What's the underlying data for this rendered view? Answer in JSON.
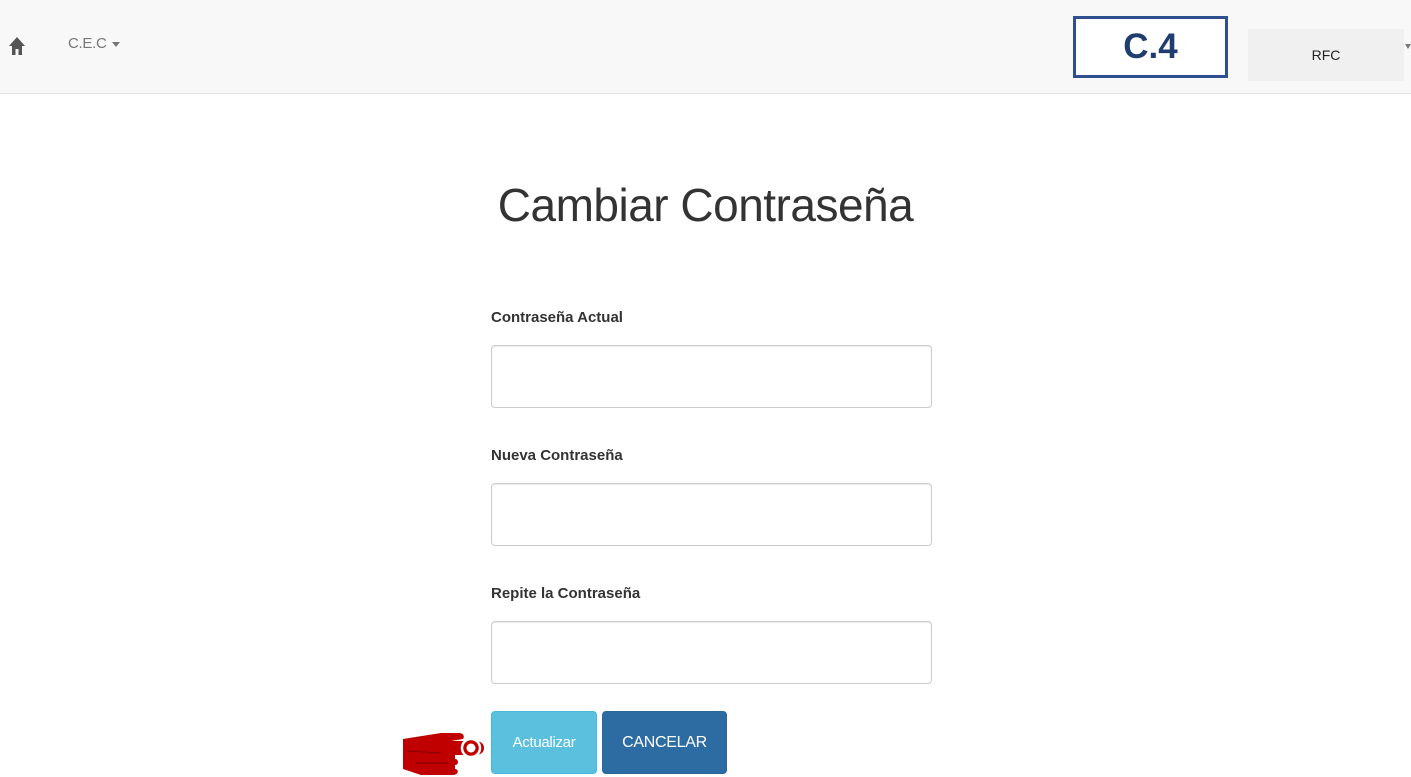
{
  "navbar": {
    "brand_label": "C.E.C",
    "home_icon": "home-icon",
    "section_tag": "C.4",
    "user_label": "RFC"
  },
  "main": {
    "title": "Cambiar Contraseña",
    "fields": [
      {
        "label": "Contraseña Actual",
        "value": ""
      },
      {
        "label": "Nueva Contraseña",
        "value": ""
      },
      {
        "label": "Repite la Contraseña",
        "value": ""
      }
    ],
    "buttons": {
      "update_label": "Actualizar",
      "cancel_label": "CANCELAR"
    }
  },
  "annotation": {
    "icon": "pointing-hand-icon"
  },
  "colors": {
    "update_button": "#5bc0de",
    "cancel_button": "#2d6ca2",
    "section_tag_border": "#2f4f8f",
    "pointer_hand": "#c00000"
  }
}
